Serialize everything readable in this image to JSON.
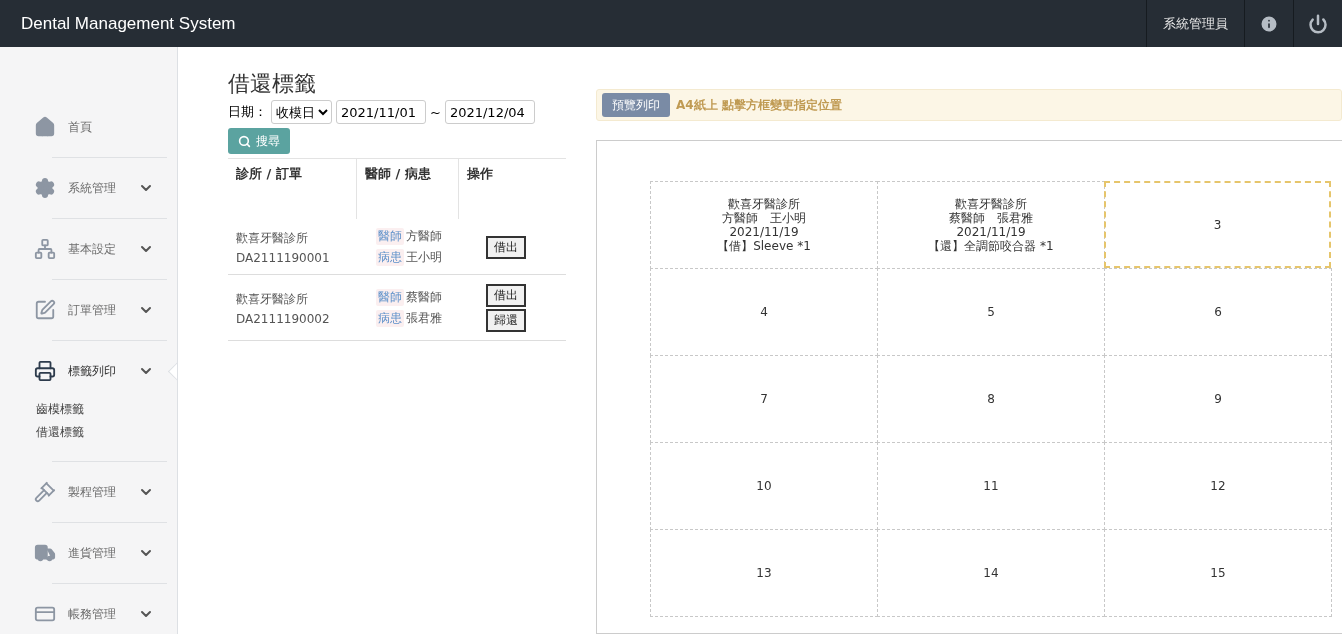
{
  "header": {
    "title": "Dental Management System",
    "user": "系統管理員"
  },
  "sidebar": {
    "items": [
      {
        "kind": "home",
        "label": "首頁",
        "active": false
      },
      {
        "kind": "gear",
        "label": "系統管理",
        "active": false
      },
      {
        "kind": "sitemap",
        "label": "基本設定",
        "active": false
      },
      {
        "kind": "edit",
        "label": "訂單管理",
        "active": false
      },
      {
        "kind": "print",
        "label": "標籤列印",
        "active": true,
        "children": [
          {
            "label": "齒模標籤"
          },
          {
            "label": "借還標籤"
          }
        ]
      },
      {
        "kind": "gavel",
        "label": "製程管理",
        "active": false
      },
      {
        "kind": "truck",
        "label": "進貨管理",
        "active": false
      },
      {
        "kind": "card",
        "label": "帳務管理",
        "active": false
      }
    ]
  },
  "page": {
    "title": "借還標籤",
    "date_label": "日期：",
    "date_type": "收模日",
    "date_from": "2021/11/01",
    "separator": "~",
    "date_to": "2021/12/04",
    "search_button": "搜尋"
  },
  "table": {
    "columns": [
      "診所 / 訂單",
      "醫師 / 病患",
      "操作"
    ],
    "rows": [
      {
        "clinic": "歡喜牙醫診所",
        "order": "DA2111190001",
        "doctor_tag": "醫師",
        "doctor": "方醫師",
        "patient_tag": "病患",
        "patient": "王小明",
        "actions": [
          "借出"
        ]
      },
      {
        "clinic": "歡喜牙醫診所",
        "order": "DA2111190002",
        "doctor_tag": "醫師",
        "doctor": "蔡醫師",
        "patient_tag": "病患",
        "patient": "張君雅",
        "actions": [
          "借出",
          "歸還"
        ]
      }
    ]
  },
  "print_bar": {
    "button": "預覽列印",
    "hint_bold": "A4紙上",
    "hint": "點擊方框變更指定位置"
  },
  "labels": [
    {
      "kind": "label",
      "selected": false,
      "lines": [
        "歡喜牙醫診所",
        "方醫師　王小明",
        "2021/11/19",
        "【借】Sleeve *1"
      ]
    },
    {
      "kind": "label",
      "selected": false,
      "lines": [
        "歡喜牙醫診所",
        "蔡醫師　張君雅",
        "2021/11/19",
        "【還】全調節咬合器 *1"
      ]
    },
    {
      "kind": "slot",
      "selected": true,
      "number": "3"
    },
    {
      "kind": "slot",
      "selected": false,
      "number": "4"
    },
    {
      "kind": "slot",
      "selected": false,
      "number": "5"
    },
    {
      "kind": "slot",
      "selected": false,
      "number": "6"
    },
    {
      "kind": "slot",
      "selected": false,
      "number": "7"
    },
    {
      "kind": "slot",
      "selected": false,
      "number": "8"
    },
    {
      "kind": "slot",
      "selected": false,
      "number": "9"
    },
    {
      "kind": "slot",
      "selected": false,
      "number": "10"
    },
    {
      "kind": "slot",
      "selected": false,
      "number": "11"
    },
    {
      "kind": "slot",
      "selected": false,
      "number": "12"
    },
    {
      "kind": "slot",
      "selected": false,
      "number": "13"
    },
    {
      "kind": "slot",
      "selected": false,
      "number": "14"
    },
    {
      "kind": "slot",
      "selected": false,
      "number": "15"
    }
  ]
}
